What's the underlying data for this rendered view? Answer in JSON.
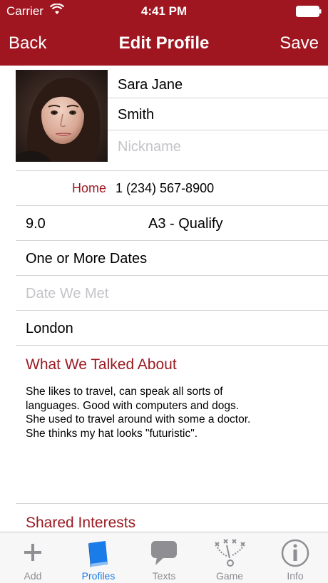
{
  "status_bar": {
    "carrier": "Carrier",
    "time": "4:41 PM"
  },
  "nav": {
    "back": "Back",
    "title": "Edit Profile",
    "save": "Save"
  },
  "profile": {
    "first_name": "Sara Jane",
    "last_name": "Smith",
    "nickname_placeholder": "Nickname",
    "phone_label": "Home",
    "phone": "1 (234) 567-8900",
    "rating": "9.0",
    "stage": "A3 - Qualify",
    "dates": "One or More Dates",
    "date_met_placeholder": "Date We Met",
    "location": "London"
  },
  "talked_about": {
    "header": "What We Talked About",
    "lines": [
      "She likes to travel, can speak all sorts of",
      "languages. Good with computers and dogs.",
      "She used to travel around with some a doctor.",
      "She thinks my hat looks \"futuristic\"."
    ]
  },
  "shared_interests": {
    "header": "Shared Interests"
  },
  "tabs": [
    {
      "label": "Add",
      "icon": "plus-icon",
      "active": false
    },
    {
      "label": "Profiles",
      "icon": "book-icon",
      "active": true
    },
    {
      "label": "Texts",
      "icon": "chat-bubble-icon",
      "active": false
    },
    {
      "label": "Game",
      "icon": "game-plan-icon",
      "active": false
    },
    {
      "label": "Info",
      "icon": "info-icon",
      "active": false
    }
  ],
  "colors": {
    "brand": "#a01620",
    "accent_text": "#9b1a22",
    "tab_active": "#1a7ce8",
    "tab_inactive": "#8e8e93"
  }
}
